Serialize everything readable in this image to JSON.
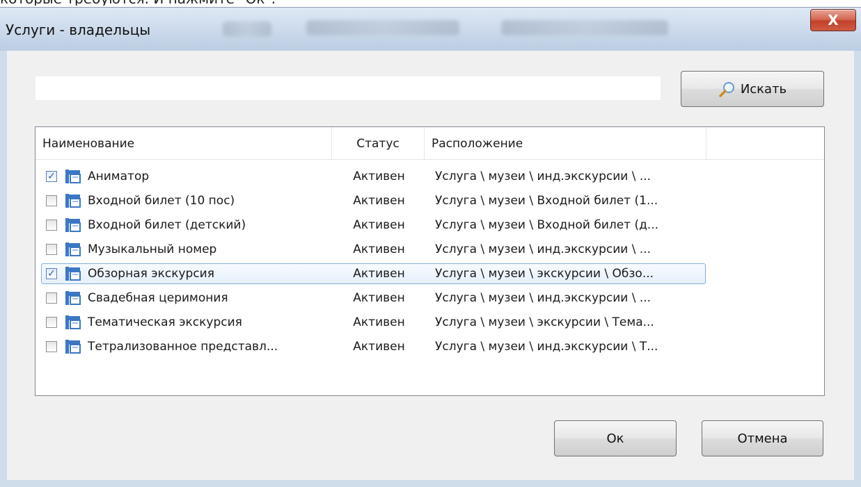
{
  "background_caption": "которые требуются. И нажмите \"Ок\".",
  "window": {
    "title": "Услуги - владельцы",
    "close_glyph": "X"
  },
  "search": {
    "value": "",
    "placeholder": "",
    "button_label": "Искать",
    "button_icon": "magnifier-icon"
  },
  "table": {
    "columns": [
      "Наименование",
      "Статус",
      "Расположение",
      ""
    ],
    "rows": [
      {
        "checked": true,
        "name": "Аниматор",
        "status": "Активен",
        "location": "Услуга \\ музеи \\ инд.экскурсии \\ ..."
      },
      {
        "checked": false,
        "name": "Входной билет (10 пос)",
        "status": "Активен",
        "location": "Услуга \\ музеи \\ Входной билет (1..."
      },
      {
        "checked": false,
        "name": "Входной билет (детский)",
        "status": "Активен",
        "location": "Услуга \\ музеи \\ Входной билет (д..."
      },
      {
        "checked": false,
        "name": "Музыкальный номер",
        "status": "Активен",
        "location": "Услуга \\ музеи \\ инд.экскурсии \\ ..."
      },
      {
        "checked": true,
        "name": "Обзорная экскурсия",
        "status": "Активен",
        "location": "Услуга \\ музеи \\ экскурсии \\ Обзо...",
        "selected": true
      },
      {
        "checked": false,
        "name": "Свадебная церимония",
        "status": "Активен",
        "location": "Услуга \\ музеи \\ инд.экскурсии \\ ..."
      },
      {
        "checked": false,
        "name": "Тематическая экскурсия",
        "status": "Активен",
        "location": "Услуга \\ музеи \\ экскурсии \\ Тема..."
      },
      {
        "checked": false,
        "name": "Тетрализованное представл...",
        "status": "Активен",
        "location": "Услуга \\ музеи \\ инд.экскурсии \\ Т..."
      }
    ]
  },
  "buttons": {
    "ok_label": "Ок",
    "cancel_label": "Отмена"
  },
  "colors": {
    "selection_border": "#84acdd",
    "close_button": "#c2412a",
    "service_icon": "#3b78c4"
  }
}
